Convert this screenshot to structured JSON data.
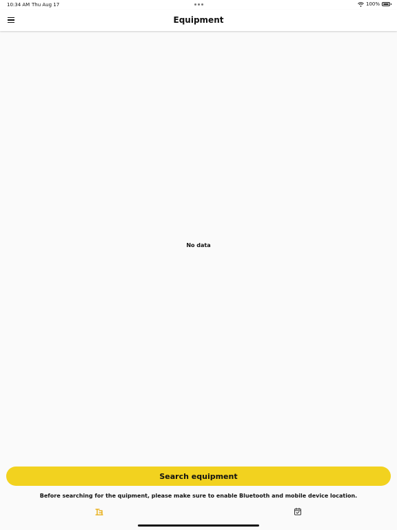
{
  "status_bar": {
    "time": "10:34 AM",
    "date": "Thu Aug 17",
    "battery": "100%",
    "icons": [
      "wifi-icon",
      "battery-icon"
    ]
  },
  "header": {
    "title": "Equipment",
    "menu_icon": "menu-icon"
  },
  "main": {
    "empty_text": "No data"
  },
  "actions": {
    "search_label": "Search equipment",
    "notice": "Before searching for the quipment, please make sure to enable Bluetooth and mobile device location."
  },
  "tab_bar": {
    "tabs": [
      {
        "icon": "equipment-icon",
        "active": true
      },
      {
        "icon": "calendar-check-icon",
        "active": false
      }
    ]
  },
  "colors": {
    "accent": "#f2d21f",
    "active_tab": "#e6a700",
    "background": "#fafafa"
  }
}
